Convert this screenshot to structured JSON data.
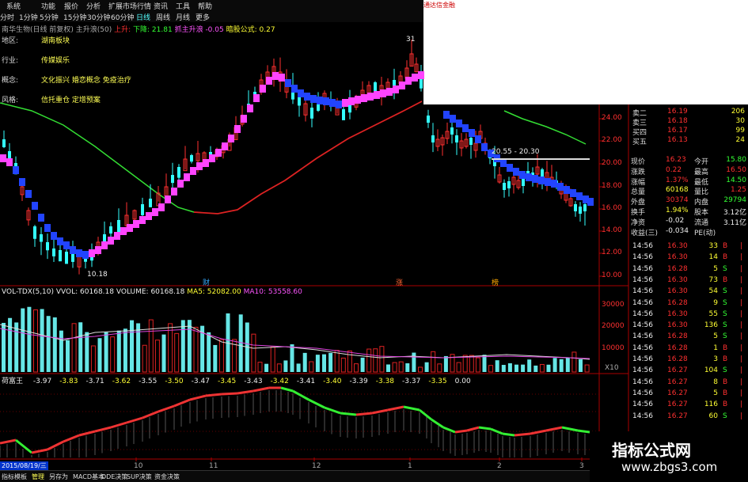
{
  "menu": [
    "系统",
    "功能",
    "报价",
    "分析",
    "扩展市场行情",
    "资讯",
    "工具",
    "帮助"
  ],
  "periods": [
    "分时",
    "1分钟",
    "5分钟",
    "15分钟",
    "30分钟",
    "60分钟",
    "日线",
    "周线",
    "月线",
    "更多"
  ],
  "active_period": "日线",
  "brand": "通达信金融",
  "stock_header": {
    "name": "南华生物(日线 前复权) 主升浪(50)",
    "rise_label": "上升:",
    "fall_label": "下降: 21.81",
    "line3": "抓主升浪 -0.05",
    "line4": "暗股公式: 0.27"
  },
  "info_box": [
    {
      "key": "地区:",
      "val": "湖南板块"
    },
    {
      "key": "行业:",
      "val": "传媒娱乐"
    },
    {
      "key": "概念:",
      "val": "文化振兴 婚恋概念 免疫治疗"
    },
    {
      "key": "风格:",
      "val": "信托重仓 定增预案"
    }
  ],
  "price_axis": [
    "24.00",
    "22.00",
    "20.00",
    "18.00",
    "16.00",
    "14.00",
    "12.00",
    "10.00"
  ],
  "price_markers": {
    "high": "31",
    "low": "10.18",
    "mid": "20.55 - 20.30"
  },
  "event_marks": [
    "财",
    "涨",
    "榜"
  ],
  "volume_header": {
    "title": "VOL-TDX(5,10)",
    "vvol": "VVOL: 60168.18",
    "volume": "VOLUME: 60168.18",
    "ma5": "MA5: 52082.00",
    "ma10": "MA10: 53558.60"
  },
  "volume_axis": [
    "30000",
    "20000",
    "10000"
  ],
  "volume_unit": "X10",
  "indicator_header": {
    "title": "荷富王",
    "values": [
      "-3.97",
      "-3.83",
      "-3.71",
      "-3.62",
      "-3.55",
      "-3.50",
      "-3.47",
      "-3.45",
      "-3.43",
      "-3.42",
      "-3.41",
      "-3.40",
      "-3.39",
      "-3.38",
      "-3.37",
      "-3.35",
      "0.00"
    ]
  },
  "x_axis": [
    "10",
    "11",
    "12",
    "1",
    "2",
    "3"
  ],
  "date_label": "2015/08/19/三",
  "bottom_tabs": [
    "指标",
    "模板",
    "管理",
    "另存为",
    "MACD基本",
    "DDE决策",
    "SUP决策",
    "资金决策"
  ],
  "quote_panel": [
    {
      "label": "卖二",
      "price": "16.19",
      "vol": "206",
      "pcolor": "red"
    },
    {
      "label": "卖三",
      "price": "16.18",
      "vol": "30",
      "pcolor": "red"
    },
    {
      "label": "买四",
      "price": "16.17",
      "vol": "99",
      "pcolor": "red"
    },
    {
      "label": "买五",
      "price": "16.13",
      "vol": "24",
      "pcolor": "red"
    }
  ],
  "stats": [
    {
      "k1": "现价",
      "v1": "16.23",
      "c1": "red",
      "k2": "今开",
      "v2": "15.80",
      "c2": "green"
    },
    {
      "k1": "涨跌",
      "v1": "0.22",
      "c1": "red",
      "k2": "最高",
      "v2": "16.50",
      "c2": "red"
    },
    {
      "k1": "涨幅",
      "v1": "1.37%",
      "c1": "red",
      "k2": "最低",
      "v2": "14.50",
      "c2": "green"
    },
    {
      "k1": "总量",
      "v1": "60168",
      "c1": "yellow",
      "k2": "量比",
      "v2": "1.25",
      "c2": "red"
    },
    {
      "k1": "外盘",
      "v1": "30374",
      "c1": "red",
      "k2": "内盘",
      "v2": "29794",
      "c2": "green"
    },
    {
      "k1": "换手",
      "v1": "1.94%",
      "c1": "yellow",
      "k2": "股本",
      "v2": "3.12亿",
      "c2": "white"
    },
    {
      "k1": "净资",
      "v1": "-0.02",
      "c1": "white",
      "k2": "流通",
      "v2": "3.11亿",
      "c2": "white"
    },
    {
      "k1": "收益(三)",
      "v1": "-0.034",
      "c1": "white",
      "k2": "PE(动)",
      "v2": "",
      "c2": "white"
    }
  ],
  "ticks": [
    {
      "time": "14:56",
      "price": "16.30",
      "vol": "33",
      "dir": "B"
    },
    {
      "time": "14:56",
      "price": "16.30",
      "vol": "14",
      "dir": "B"
    },
    {
      "time": "14:56",
      "price": "16.28",
      "vol": "5",
      "dir": "S"
    },
    {
      "time": "14:56",
      "price": "16.30",
      "vol": "73",
      "dir": "B"
    },
    {
      "time": "14:56",
      "price": "16.30",
      "vol": "54",
      "dir": "S"
    },
    {
      "time": "14:56",
      "price": "16.28",
      "vol": "9",
      "dir": "S"
    },
    {
      "time": "14:56",
      "price": "16.30",
      "vol": "55",
      "dir": "S"
    },
    {
      "time": "14:56",
      "price": "16.30",
      "vol": "136",
      "dir": "S"
    },
    {
      "time": "14:56",
      "price": "16.28",
      "vol": "5",
      "dir": "S"
    },
    {
      "time": "14:56",
      "price": "16.28",
      "vol": "1",
      "dir": "B"
    },
    {
      "time": "14:56",
      "price": "16.28",
      "vol": "3",
      "dir": "B"
    },
    {
      "time": "14:56",
      "price": "16.27",
      "vol": "104",
      "dir": "S"
    },
    {
      "time": "14:56",
      "price": "16.27",
      "vol": "8",
      "dir": "B"
    },
    {
      "time": "14:56",
      "price": "16.27",
      "vol": "5",
      "dir": "B"
    },
    {
      "time": "14:56",
      "price": "16.27",
      "vol": "116",
      "dir": "B"
    },
    {
      "time": "14:56",
      "price": "16.27",
      "vol": "60",
      "dir": "S"
    }
  ],
  "watermark": {
    "title": "指标公式网",
    "url": "www.zbgs3.com"
  }
}
